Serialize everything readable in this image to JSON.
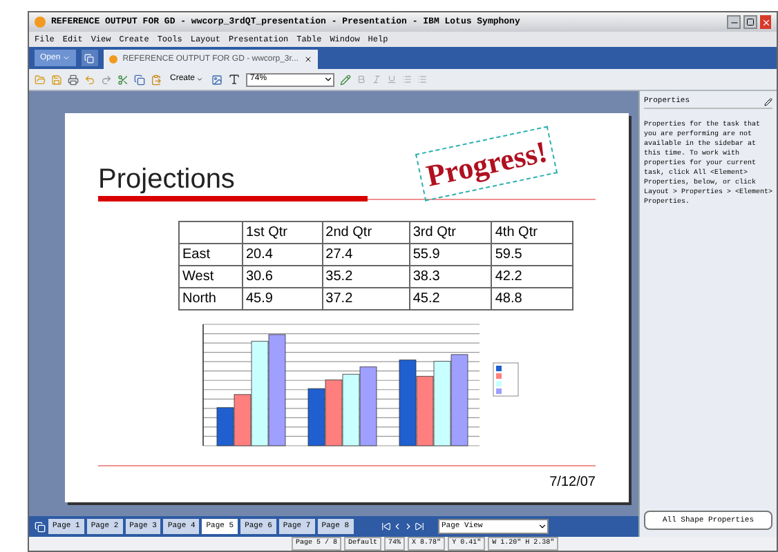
{
  "window": {
    "title": "REFERENCE OUTPUT FOR GD - wwcorp_3rdQT_presentation - Presentation - IBM Lotus Symphony"
  },
  "menu": [
    "File",
    "Edit",
    "View",
    "Create",
    "Tools",
    "Layout",
    "Presentation",
    "Table",
    "Window",
    "Help"
  ],
  "tab_bar": {
    "open_button": "Open",
    "document_tab": "REFERENCE OUTPUT FOR GD - wwcorp_3r..."
  },
  "toolbar": {
    "create_button": "Create",
    "zoom": "74%"
  },
  "slide": {
    "title": "Projections",
    "wordart": "Progress!",
    "table": {
      "columns": [
        "1st Qtr",
        "2nd Qtr",
        "3rd Qtr",
        "4th Qtr"
      ],
      "rows": [
        {
          "label": "East",
          "cells": [
            "20.4",
            "27.4",
            "55.9",
            "59.5"
          ]
        },
        {
          "label": "West",
          "cells": [
            "30.6",
            "35.2",
            "38.3",
            "42.2"
          ]
        },
        {
          "label": "North",
          "cells": [
            "45.9",
            "37.2",
            "45.2",
            "48.8"
          ]
        }
      ]
    },
    "date": "7/12/07"
  },
  "properties_panel": {
    "title": "Properties",
    "text": "Properties for the task that you are performing are not available in the sidebar at this time. To work with properties for your current task, click All <Element> Properties, below, or click Layout > Properties > <Element> Properties.",
    "button": "All Shape Properties"
  },
  "page_tabs": [
    {
      "label": "Page 1",
      "selected": false
    },
    {
      "label": "Page 2",
      "selected": false
    },
    {
      "label": "Page 3",
      "selected": false
    },
    {
      "label": "Page 4",
      "selected": false
    },
    {
      "label": "Page 5",
      "selected": true
    },
    {
      "label": "Page 6",
      "selected": false
    },
    {
      "label": "Page 7",
      "selected": false
    },
    {
      "label": "Page 8",
      "selected": false
    }
  ],
  "view_select": "Page View",
  "status_bar": [
    "Page 5 / 8",
    "Default",
    "74%",
    "X 8.78\"",
    "Y 0.41\"",
    "W 1.20\" H 2.38\""
  ]
}
